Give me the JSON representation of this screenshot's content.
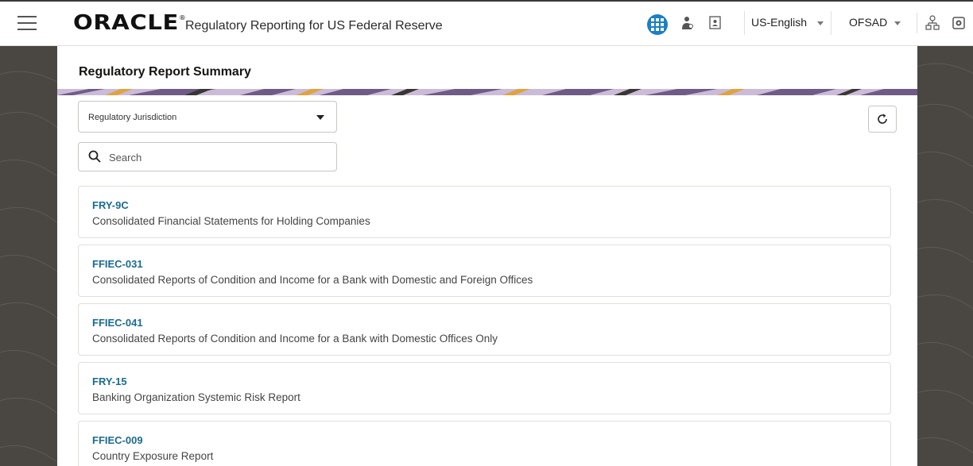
{
  "header": {
    "logo_text": "ORACLE",
    "logo_mark": "®",
    "app_title": "Regulatory Reporting for US Federal Reserve",
    "icons": {
      "menu": "hamburger-menu-icon",
      "apps": "apps-grid-icon",
      "user": "user-icon",
      "contact": "contact-card-icon",
      "hierarchy": "hierarchy-icon",
      "camera": "camera-icon"
    },
    "language": "US-English",
    "user": "OFSAD",
    "accent_color": "#1b7fc4"
  },
  "page": {
    "title": "Regulatory Report Summary",
    "jurisdiction_placeholder": "Regulatory Jurisdiction",
    "search_placeholder": "Search",
    "search_value": "",
    "refresh_icon": "refresh-icon"
  },
  "reports": [
    {
      "code": "FRY-9C",
      "description": "Consolidated Financial Statements for Holding Companies"
    },
    {
      "code": "FFIEC-031",
      "description": "Consolidated Reports of Condition and Income for a Bank with Domestic and Foreign Offices"
    },
    {
      "code": "FFIEC-041",
      "description": "Consolidated Reports of Condition and Income for a Bank with Domestic Offices Only"
    },
    {
      "code": "FRY-15",
      "description": "Banking Organization Systemic Risk Report"
    },
    {
      "code": "FFIEC-009",
      "description": "Country Exposure Report"
    }
  ],
  "colors": {
    "link": "#1a6b8f",
    "side_panel": "#4a4742"
  }
}
